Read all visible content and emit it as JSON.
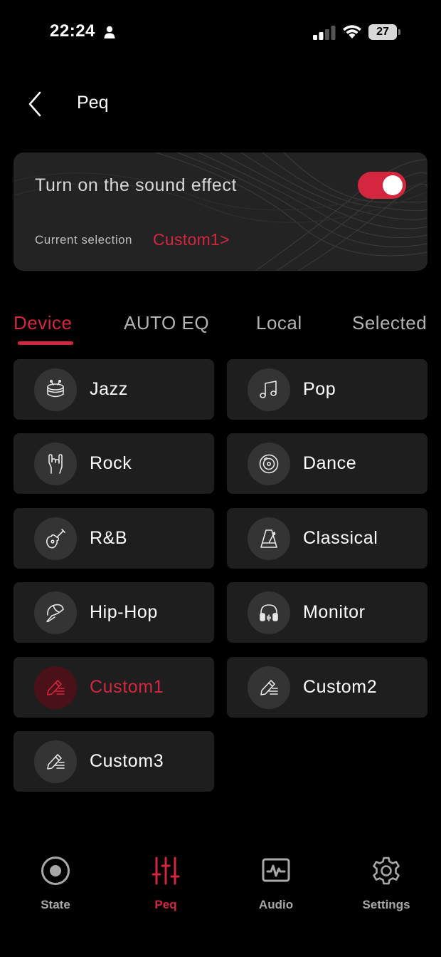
{
  "status_bar": {
    "time": "22:24",
    "battery": "27"
  },
  "header": {
    "title": "Peq"
  },
  "effect_card": {
    "title": "Turn on the sound effect",
    "toggle_on": true,
    "current_label": "Current selection",
    "current_value": "Custom1>"
  },
  "tabs": [
    {
      "label": "Device",
      "active": true
    },
    {
      "label": "AUTO EQ",
      "active": false
    },
    {
      "label": "Local",
      "active": false
    },
    {
      "label": "Selected",
      "active": false
    }
  ],
  "presets": [
    {
      "label": "Jazz",
      "icon": "drum-icon"
    },
    {
      "label": "Pop",
      "icon": "music-note-icon"
    },
    {
      "label": "Rock",
      "icon": "rock-hand-icon"
    },
    {
      "label": "Dance",
      "icon": "vinyl-record-icon"
    },
    {
      "label": "R&B",
      "icon": "guitar-icon"
    },
    {
      "label": "Classical",
      "icon": "metronome-icon"
    },
    {
      "label": "Hip-Hop",
      "icon": "cap-icon"
    },
    {
      "label": "Monitor",
      "icon": "headphones-icon"
    },
    {
      "label": "Custom1",
      "icon": "edit-pen-icon",
      "active": true
    },
    {
      "label": "Custom2",
      "icon": "edit-pen-icon"
    },
    {
      "label": "Custom3",
      "icon": "edit-pen-icon"
    }
  ],
  "bottom_nav": [
    {
      "label": "State",
      "icon": "state-icon",
      "active": false
    },
    {
      "label": "Peq",
      "icon": "equalizer-sliders-icon",
      "active": true
    },
    {
      "label": "Audio",
      "icon": "audio-waveform-icon",
      "active": false
    },
    {
      "label": "Settings",
      "icon": "gear-icon",
      "active": false
    }
  ],
  "colors": {
    "accent": "#d4263f",
    "background": "#000000",
    "card": "#1e1e1e",
    "icon_circle": "#343434"
  }
}
